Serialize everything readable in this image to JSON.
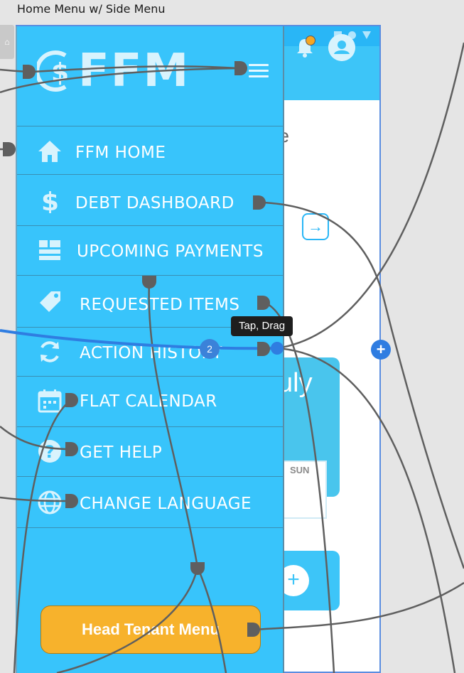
{
  "artboard": {
    "title": "Home Menu w/ Side Menu"
  },
  "background_screen": {
    "partial_heading": "ge",
    "calendar_month": "July",
    "calendar_day": "SUN",
    "add_symbol": "+",
    "arrow_symbol": "→"
  },
  "side_menu": {
    "logo_text": "FFM",
    "items": [
      {
        "label": "FFM HOME",
        "icon": "home-icon"
      },
      {
        "label": "DEBT DASHBOARD",
        "icon": "dollar-icon"
      },
      {
        "label": "UPCOMING PAYMENTS",
        "icon": "dashboard-icon"
      },
      {
        "label": "REQUESTED ITEMS",
        "icon": "tag-icon"
      },
      {
        "label": "ACTION HISTORY",
        "icon": "refresh-icon"
      },
      {
        "label": "FLAT CALENDAR",
        "icon": "calendar-icon"
      },
      {
        "label": "GET HELP",
        "icon": "help-icon"
      },
      {
        "label": "CHANGE LANGUAGE",
        "icon": "globe-icon"
      }
    ],
    "head_tenant_button": "Head Tenant Menu"
  },
  "prototype": {
    "tooltip": "Tap, Drag",
    "connection_count": "2",
    "add_symbol": "+"
  },
  "colors": {
    "menu_bg": "#38c4fb",
    "accent_orange": "#f7b22c",
    "wire": "#5f5f5f",
    "selected_wire": "#2f7de1"
  }
}
